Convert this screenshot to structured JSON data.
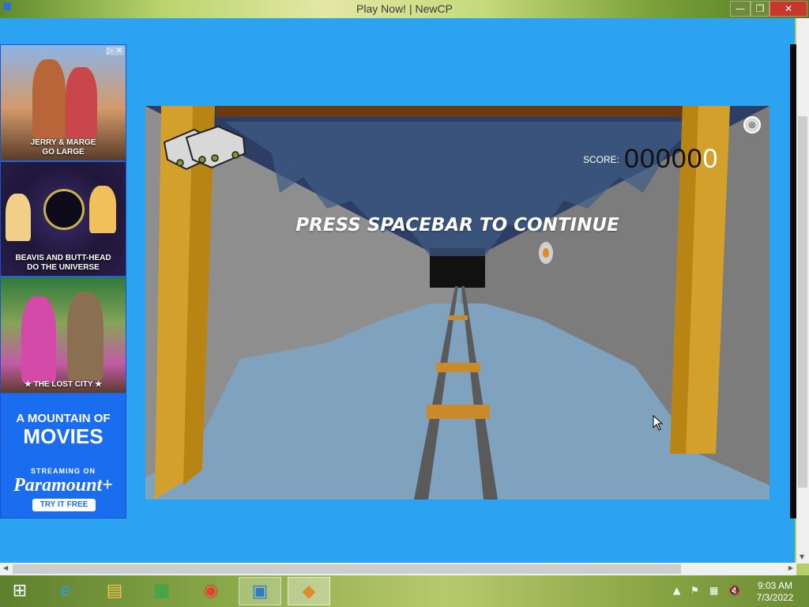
{
  "window": {
    "title": "Play Now! | NewCP",
    "minimize_label": "—",
    "maximize_label": "❐",
    "close_label": "✕"
  },
  "ads": {
    "adchoices_label": "▷ ✕",
    "panels": [
      {
        "caption": "JERRY & MARGE\nGO LARGE"
      },
      {
        "caption": "BEAVIS AND BUTT-HEAD\nDO THE UNIVERSE"
      },
      {
        "caption": "★ THE LOST CITY ★"
      }
    ],
    "paramount": {
      "line1": "A MOUNTAIN OF",
      "line2": "MOVIES",
      "streaming": "STREAMING ON",
      "brand": "Paramount+",
      "cta": "TRY IT FREE"
    }
  },
  "game": {
    "score_label": "SCORE:",
    "score_main": "00000",
    "score_last": "0",
    "message": "PRESS SPACEBAR TO CONTINUE",
    "close_label": "⊗"
  },
  "taskbar": {
    "start_label": "⊞",
    "clock_time": "9:03 AM",
    "clock_date": "7/3/2022",
    "tray_up": "▲",
    "tray_flag": "⚑",
    "tray_net": "▦",
    "tray_vol": "🔇"
  },
  "icons": [
    "windows-logo-icon",
    "internet-explorer-icon",
    "file-explorer-icon",
    "store-icon",
    "chrome-icon",
    "control-panel-icon",
    "game-app-icon"
  ],
  "colors": {
    "page_bg": "#2ca3f0",
    "close_button": "#c7372b",
    "beam": "#d4a02c"
  }
}
